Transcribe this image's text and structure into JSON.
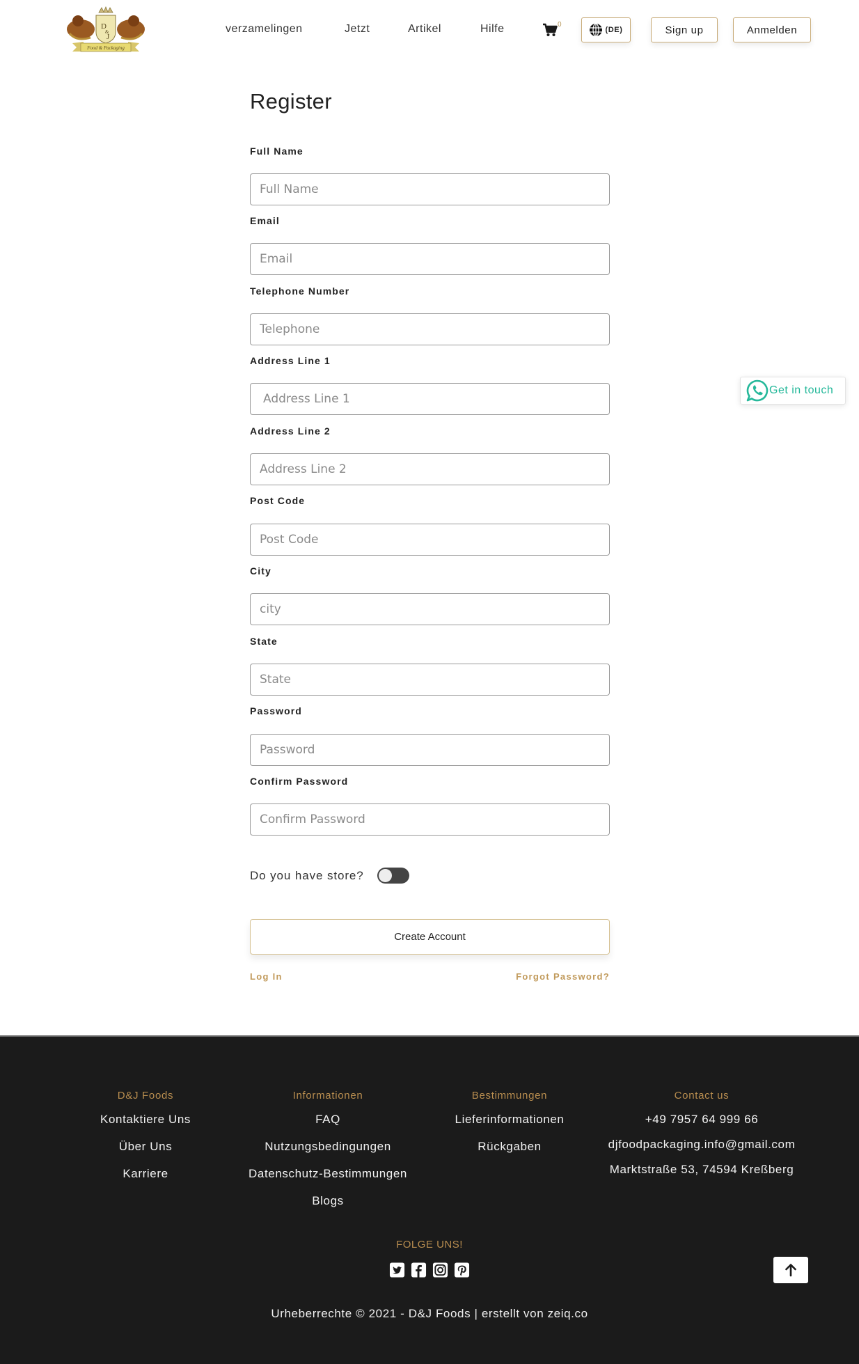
{
  "header": {
    "logo_alt": "D&J Food & Packaging",
    "nav": [
      "verzamelingen",
      "Jetzt",
      "Artikel",
      "Hilfe"
    ],
    "cart_count": "0",
    "language_label": "(DE)",
    "signup_label": "Sign up",
    "login_label": "Anmelden"
  },
  "form": {
    "title": "Register",
    "fields": [
      {
        "label": "Full Name",
        "placeholder": "Full Name",
        "value": ""
      },
      {
        "label": "Email",
        "placeholder": "Email",
        "value": ""
      },
      {
        "label": "Telephone Number",
        "placeholder": "Telephone",
        "value": ""
      },
      {
        "label": "Address Line 1",
        "placeholder": "Address Line 1",
        "value": ""
      },
      {
        "label": "Address Line 2",
        "placeholder": "Address Line 2",
        "value": ""
      },
      {
        "label": "Post Code",
        "placeholder": "Post Code",
        "value": ""
      },
      {
        "label": "City",
        "placeholder": "city",
        "value": ""
      },
      {
        "label": "State",
        "placeholder": "State",
        "value": ""
      },
      {
        "label": "Password",
        "placeholder": "Password",
        "value": ""
      },
      {
        "label": "Confirm Password",
        "placeholder": "Confirm Password",
        "value": ""
      }
    ],
    "store_question": "Do you have store?",
    "store_toggle_on": false,
    "create_account_label": "Create Account",
    "login_link": "Log In",
    "forgot_password_link": "Forgot Password?"
  },
  "whatsapp": {
    "label": "Get in touch",
    "color": "#25b89a"
  },
  "footer": {
    "columns": [
      {
        "heading": "D&J Foods",
        "items": [
          "Kontaktiere Uns",
          "Über Uns",
          "Karriere"
        ]
      },
      {
        "heading": "Informationen",
        "items": [
          "FAQ",
          "Nutzungsbedingungen",
          "Datenschutz-Bestimmungen",
          "Blogs"
        ]
      },
      {
        "heading": "Bestimmungen",
        "items": [
          "Lieferinformationen",
          "Rückgaben"
        ]
      },
      {
        "heading": "Contact us",
        "items": [
          "+49 7957 64 999 66",
          "djfoodpackaging.info@gmail.com",
          "Marktstraße 53, 74594 Kreßberg"
        ]
      }
    ],
    "follow_label": "FOLGE UNS!",
    "socials": [
      "twitter-icon",
      "facebook-icon",
      "instagram-icon",
      "pinterest-icon"
    ],
    "copyright": "Urheberrechte © 2021 - D&J Foods | erstellt von zeiq.co"
  },
  "colors": {
    "accent_gold": "#b88d4f",
    "footer_bg": "#1b1b1b",
    "button_border": "#c8ab78"
  }
}
